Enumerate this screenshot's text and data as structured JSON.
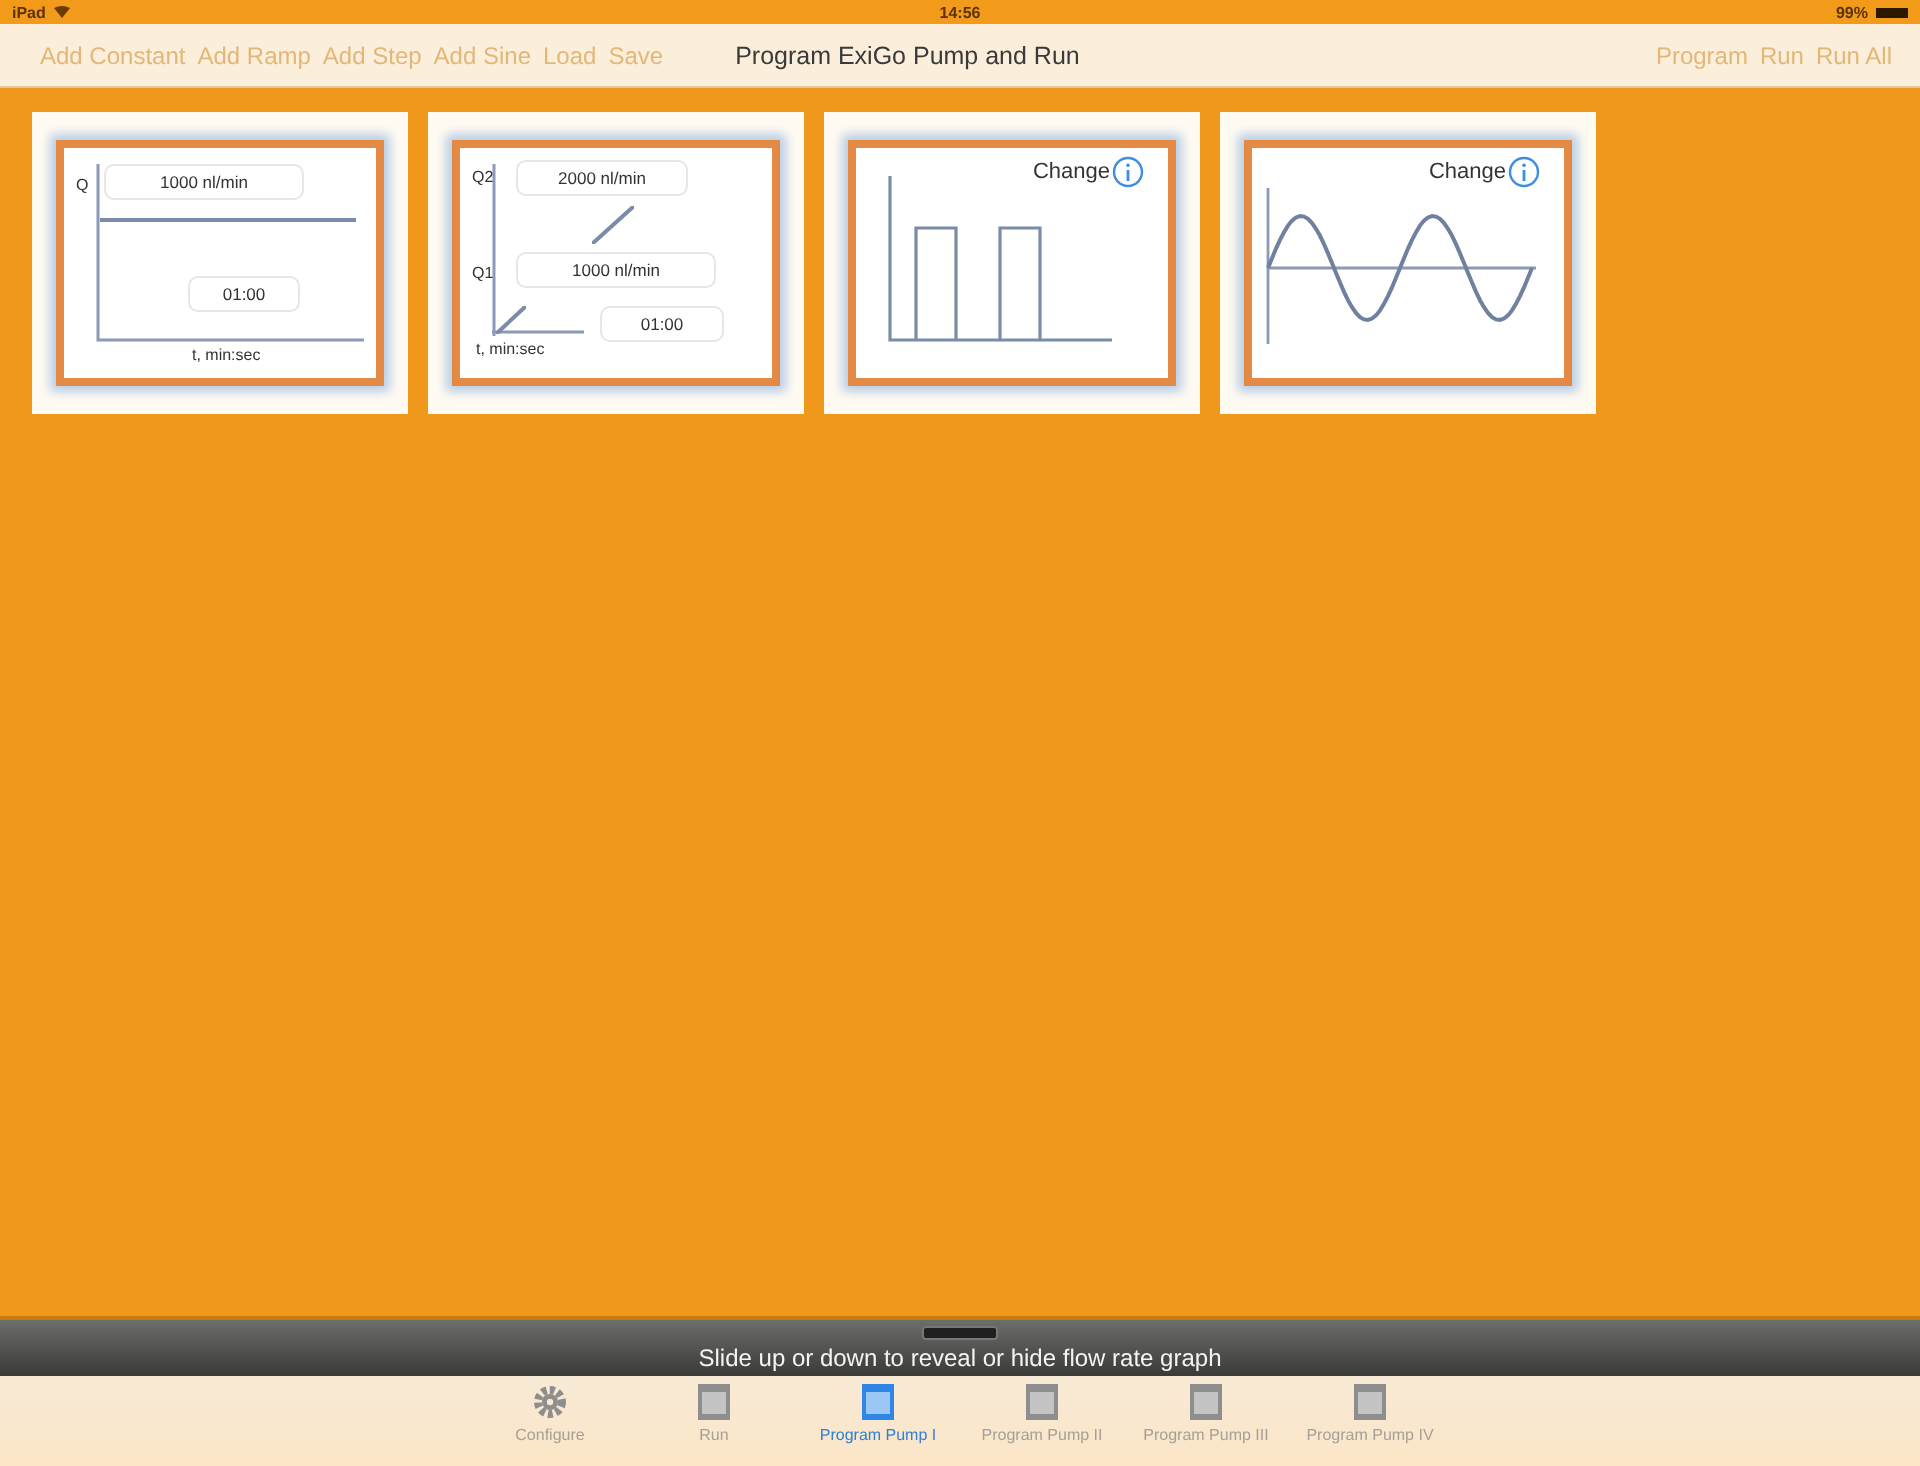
{
  "status_bar": {
    "device": "iPad",
    "time": "14:56",
    "battery": "99%"
  },
  "toolbar": {
    "left_buttons": [
      "Add Constant",
      "Add Ramp",
      "Add Step",
      "Add Sine",
      "Load",
      "Save"
    ],
    "title": "Program ExiGo Pump and Run",
    "right_buttons": [
      "Program",
      "Run",
      "Run All"
    ]
  },
  "segments": [
    {
      "kind": "constant",
      "q_label": "Q",
      "rate": "1000 nl/min",
      "duration": "01:00",
      "axis_label": "t, min:sec"
    },
    {
      "kind": "ramp",
      "q2_label": "Q2",
      "rate_end": "2000 nl/min",
      "q1_label": "Q1",
      "rate_start": "1000 nl/min",
      "axis_label": "t, min:sec",
      "duration": "01:00"
    },
    {
      "kind": "step",
      "action": "Change"
    },
    {
      "kind": "sine",
      "action": "Change"
    }
  ],
  "graph_drawer": {
    "hint": "Slide up or down to reveal or hide flow rate graph"
  },
  "tabs": [
    {
      "label": "Configure",
      "selected": false
    },
    {
      "label": "Run",
      "selected": false
    },
    {
      "label": "Program Pump I",
      "selected": true
    },
    {
      "label": "Program Pump II",
      "selected": false
    },
    {
      "label": "Program Pump III",
      "selected": false
    },
    {
      "label": "Program Pump IV",
      "selected": false
    }
  ]
}
